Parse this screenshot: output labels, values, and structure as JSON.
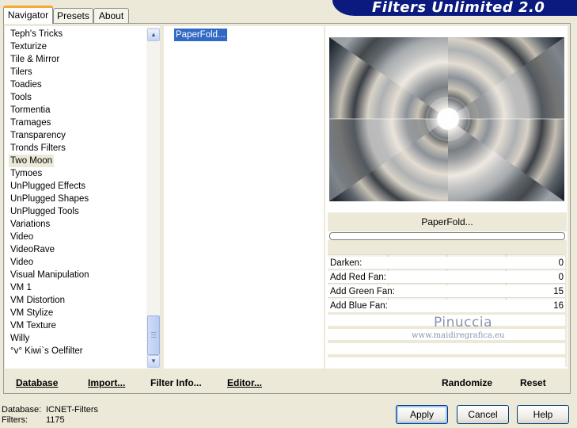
{
  "tabs": [
    "Navigator",
    "Presets",
    "About"
  ],
  "banner_title": "Filters Unlimited 2.0",
  "categories": [
    "Teph's Tricks",
    "Texturize",
    "Tile & Mirror",
    "Tilers",
    "Toadies",
    "Tools",
    "Tormentia",
    "Tramages",
    "Transparency",
    "Tronds Filters",
    "Two Moon",
    "Tymoes",
    "UnPlugged Effects",
    "UnPlugged Shapes",
    "UnPlugged Tools",
    "Variations",
    "Video",
    "VideoRave",
    "Video",
    "Visual Manipulation",
    "VM 1",
    "VM Distortion",
    "VM Stylize",
    "VM Texture",
    "Willy",
    "°v° Kiwi`s Oelfilter"
  ],
  "selected_category": "Two Moon",
  "filters": [
    "PaperFold..."
  ],
  "filter_name": "PaperFold...",
  "parameters": [
    {
      "label": "Darken:",
      "value": "0"
    },
    {
      "label": "Add Red Fan:",
      "value": "0"
    },
    {
      "label": "Add Green Fan:",
      "value": "15"
    },
    {
      "label": "Add Blue Fan:",
      "value": "16"
    }
  ],
  "watermark": {
    "name": "Pinuccia",
    "url": "www.maidiregrafica.eu"
  },
  "actions": {
    "database": "Database",
    "import": "Import...",
    "filter_info": "Filter Info...",
    "editor": "Editor...",
    "randomize": "Randomize",
    "reset": "Reset"
  },
  "status": {
    "database_label": "Database:",
    "database_value": "ICNET-Filters",
    "filters_label": "Filters:",
    "filters_value": "1175"
  },
  "buttons": {
    "apply": "Apply",
    "cancel": "Cancel",
    "help": "Help"
  },
  "icons": {
    "scroll_up": "chevron-up-icon",
    "scroll_down": "chevron-down-icon",
    "thumb_grip": "grip-icon"
  }
}
